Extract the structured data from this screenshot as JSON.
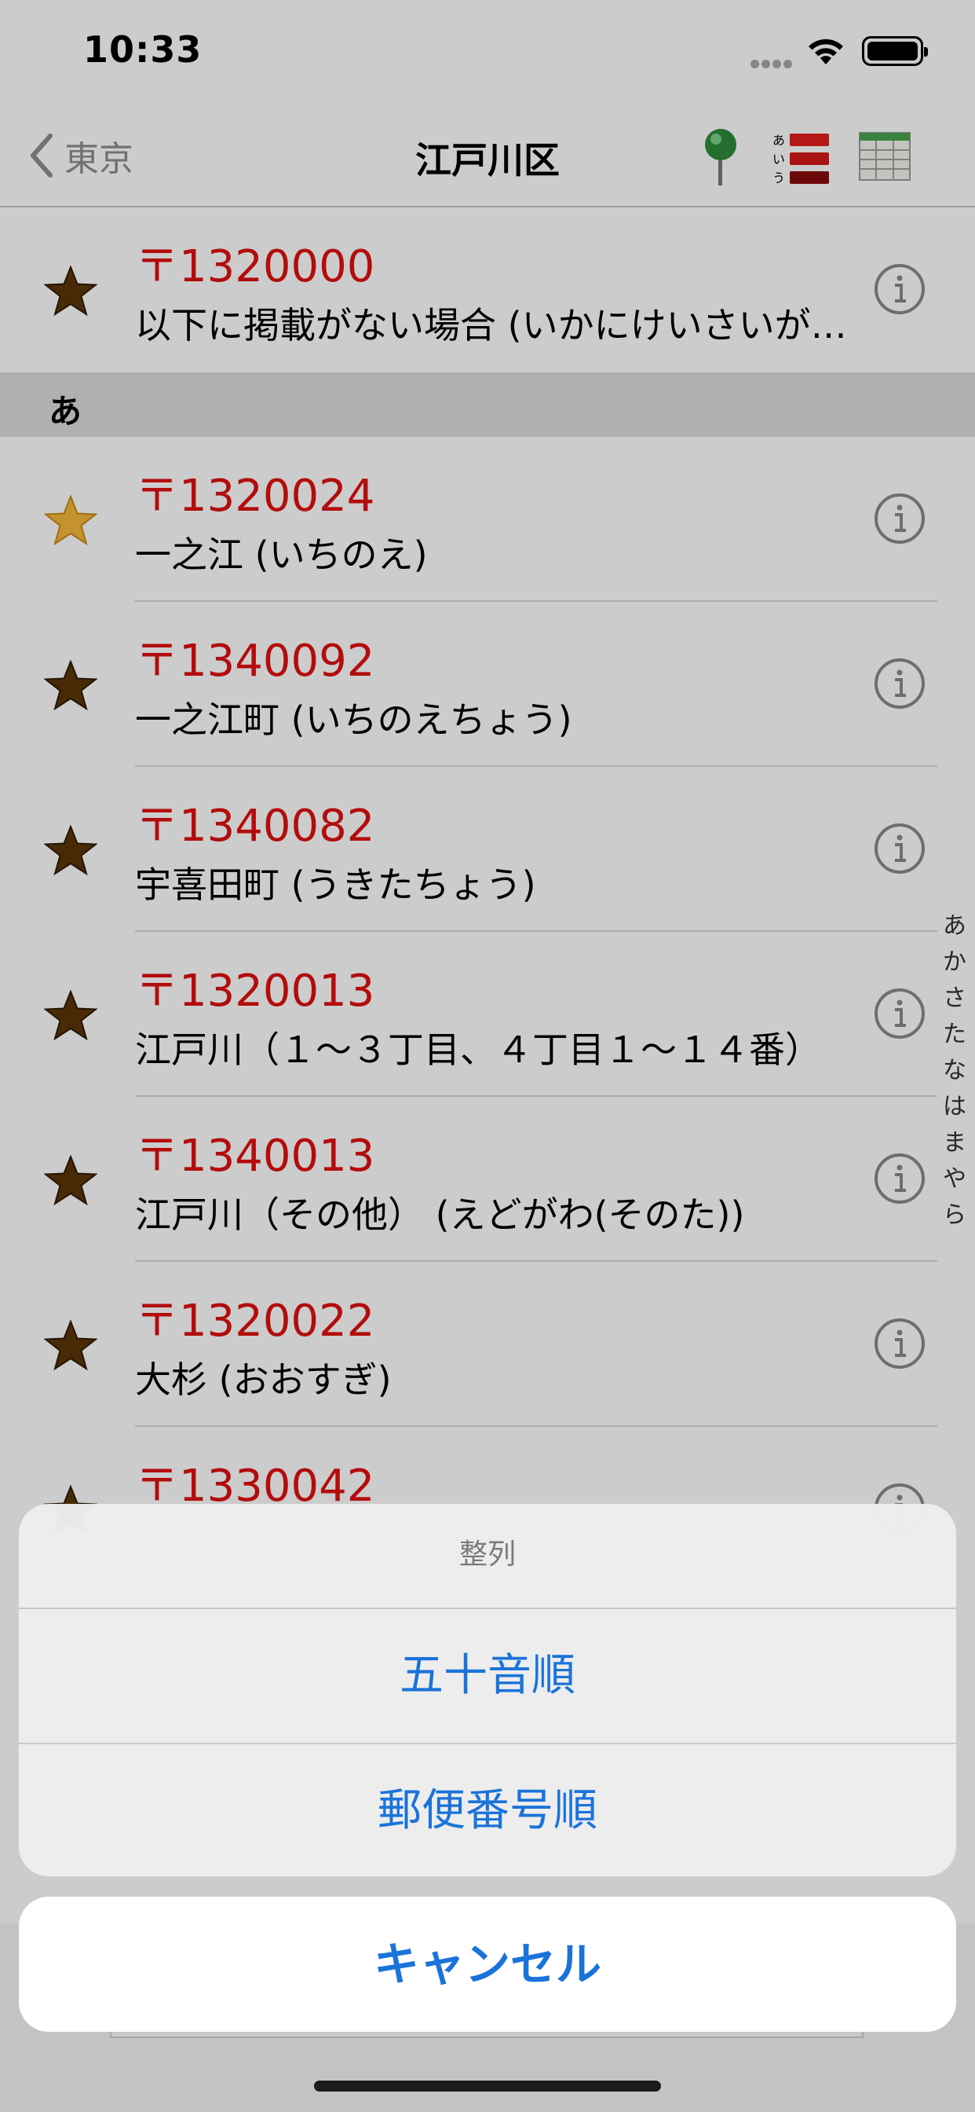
{
  "status_bar": {
    "time": "10:33"
  },
  "nav": {
    "back_label": "東京",
    "title": "江戸川区",
    "icons": [
      "map-pin-icon",
      "kana-sort-icon",
      "table-grid-icon"
    ]
  },
  "list": {
    "top_row": {
      "zip": "〒1320000",
      "name": "以下に掲載がない場合 (いかにけいさいがないばあい)",
      "favorite": false
    },
    "section_a": {
      "header": "あ",
      "rows": [
        {
          "zip": "〒1320024",
          "name": "一之江 (いちのえ)",
          "favorite": true
        },
        {
          "zip": "〒1340092",
          "name": "一之江町 (いちのえちょう)",
          "favorite": false
        },
        {
          "zip": "〒1340082",
          "name": "宇喜田町 (うきたちょう)",
          "favorite": false
        },
        {
          "zip": "〒1320013",
          "name": "江戸川（１～３丁目、４丁目１～１４番）",
          "favorite": false
        },
        {
          "zip": "〒1340013",
          "name": "江戸川（その他） (えどがわ(そのた))",
          "favorite": false
        },
        {
          "zip": "〒1320022",
          "name": "大杉 (おおすぎ)",
          "favorite": false
        },
        {
          "zip": "〒1330042",
          "name": "",
          "favorite": false
        }
      ]
    }
  },
  "index_letters": [
    "あ",
    "か",
    "さ",
    "た",
    "な",
    "は",
    "ま",
    "や",
    "ら"
  ],
  "action_sheet": {
    "title": "整列",
    "options": [
      "五十音順",
      "郵便番号順"
    ],
    "cancel": "キャンセル"
  },
  "colors": {
    "accent": "#1a73d9",
    "zip_red": "#e01010",
    "star_gold": "#f5b73a",
    "star_brown": "#5a3508"
  }
}
